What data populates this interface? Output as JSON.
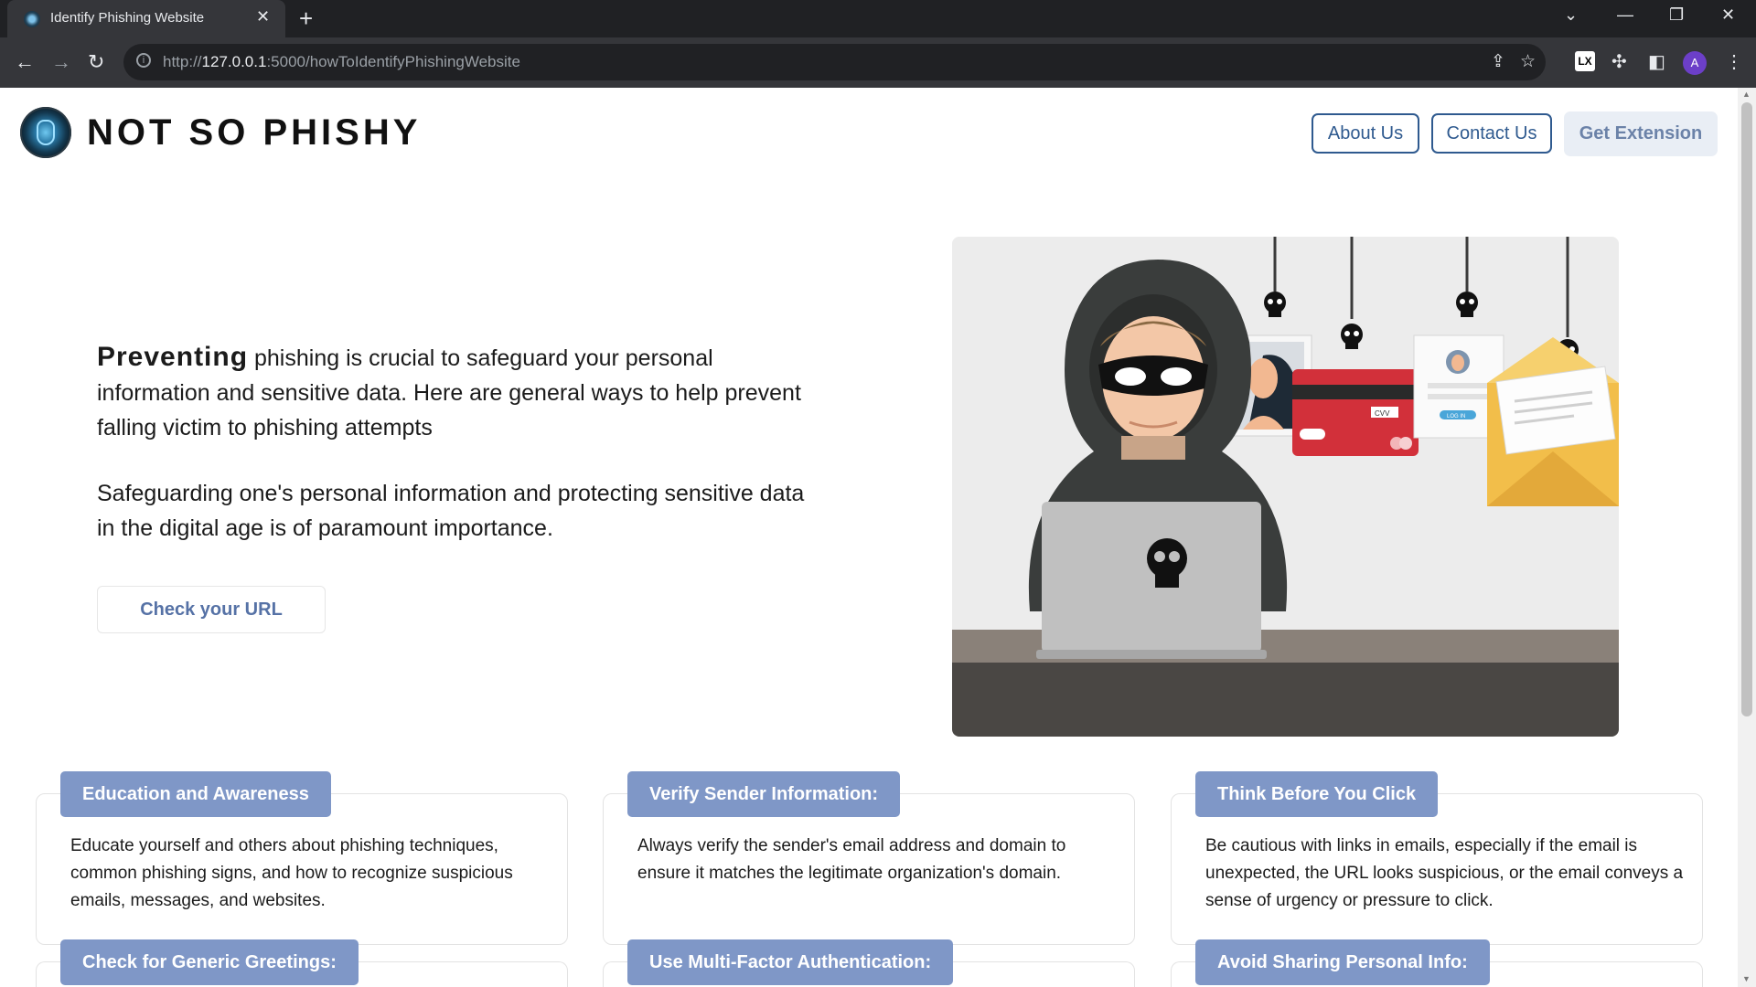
{
  "browser": {
    "tab_title": "Identify Phishing Website",
    "url_scheme": "http://",
    "url_host": "127.0.0.1",
    "url_rest": ":5000/howToIdentifyPhishingWebsite",
    "profile_initial": "A",
    "ext_label": "LX"
  },
  "header": {
    "brand": "NOT SO PHISHY",
    "nav": {
      "about": "About Us",
      "contact": "Contact Us",
      "extension": "Get Extension"
    }
  },
  "hero": {
    "lead_word": "Preventing",
    "paragraph1_rest": " phishing is crucial to safeguard your personal information and sensitive data. Here are general ways to help prevent falling victim to phishing attempts",
    "paragraph2": "Safeguarding one's personal information and protecting sensitive data in the digital age is of paramount importance.",
    "check_button": "Check your URL",
    "illustration": {
      "card_text": "CVV",
      "login_text": "LOG IN"
    }
  },
  "tips": [
    {
      "title": "Education and Awareness",
      "body": "Educate yourself and others about phishing techniques, common phishing signs, and how to recognize suspicious emails, messages, and websites."
    },
    {
      "title": "Verify Sender Information:",
      "body": "Always verify the sender's email address and domain to ensure it matches the legitimate organization's domain."
    },
    {
      "title": "Think Before You Click",
      "body": "Be cautious with links in emails, especially if the email is unexpected, the URL looks suspicious, or the email conveys a sense of urgency or pressure to click."
    },
    {
      "title": "Check for Generic Greetings:"
    },
    {
      "title": "Use Multi-Factor Authentication:"
    },
    {
      "title": "Avoid Sharing Personal Info:"
    }
  ],
  "colors": {
    "accent": "#2f5a8f",
    "tag_bg": "#7f97c7",
    "chrome_dark": "#202124",
    "chrome_toolbar": "#35363a"
  }
}
